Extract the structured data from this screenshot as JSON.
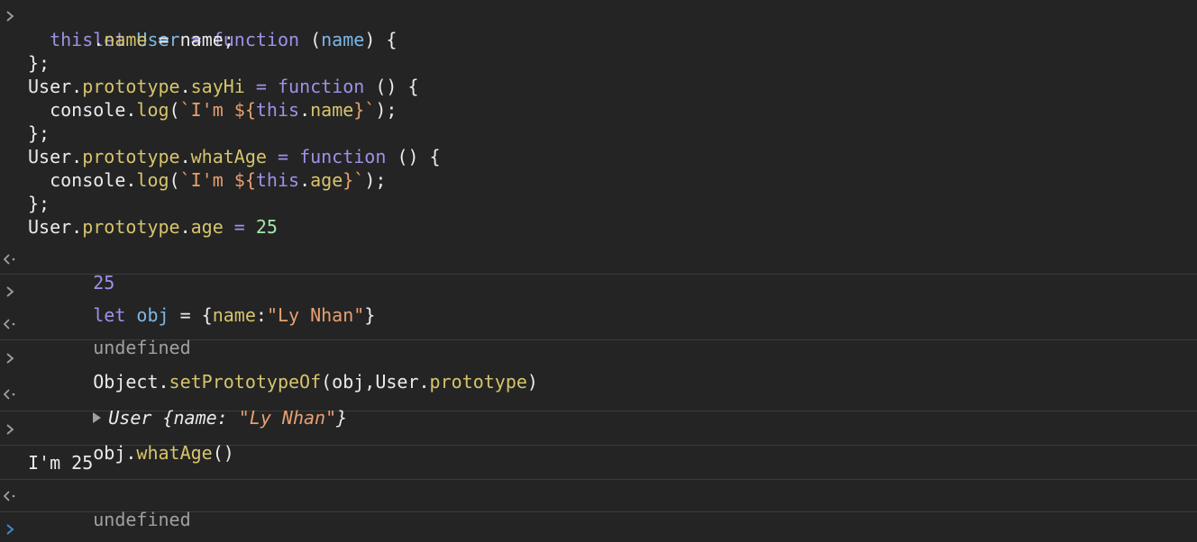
{
  "colors": {
    "background": "#242424",
    "divider": "#3c3c3c",
    "keyword": "#9c93e8",
    "variable": "#7cb7e8",
    "property": "#d6c46c",
    "string": "#e8a070",
    "number": "#a3e6a8",
    "plain": "#ebebeb",
    "muted": "#a0a0a0",
    "prompt": "#3b8bd8"
  },
  "icons": {
    "input": "chevron-right-icon",
    "result": "return-arrow-icon",
    "prompt": "prompt-caret-icon",
    "expand": "expand-triangle-icon"
  },
  "entries": {
    "e1": {
      "input": {
        "l1": {
          "a": "let ",
          "b": "User",
          "c": " = ",
          "d": "function ",
          "e": "(",
          "f": "name",
          "g": ") {"
        },
        "l2": {
          "a": "  ",
          "b": "this",
          "c": ".",
          "d": "name",
          "e": " = name;"
        },
        "l3": {
          "a": "};"
        },
        "l4": {
          "a": "User.",
          "b": "prototype",
          "c": ".",
          "d": "sayHi",
          "e": " = ",
          "f": "function ",
          "g": "() {"
        },
        "l5": {
          "a": "  console.",
          "b": "log",
          "c": "(",
          "d": "`I'm ${",
          "e": "this",
          "f": ".",
          "g": "name",
          "h": "}`",
          "i": ");"
        },
        "l6": {
          "a": "};"
        },
        "l7": {
          "a": "User.",
          "b": "prototype",
          "c": ".",
          "d": "whatAge",
          "e": " = ",
          "f": "function ",
          "g": "() {"
        },
        "l8": {
          "a": "  console.",
          "b": "log",
          "c": "(",
          "d": "`I'm ${",
          "e": "this",
          "f": ".",
          "g": "age",
          "h": "}`",
          "i": ");"
        },
        "l9": {
          "a": "};"
        },
        "l10": {
          "a": "User.",
          "b": "prototype",
          "c": ".",
          "d": "age",
          "e": " = ",
          "f": "25"
        }
      },
      "result": "25"
    },
    "e2": {
      "input": {
        "a": "let ",
        "b": "obj",
        "c": " = {",
        "d": "name",
        "e": ":",
        "f": "\"Ly Nhan\"",
        "g": "}"
      },
      "result": "undefined"
    },
    "e3": {
      "input": {
        "a": "Object.",
        "b": "setPrototypeOf",
        "c": "(obj,User.",
        "d": "prototype",
        "e": ")"
      },
      "result": {
        "a": "User {",
        "b": "name",
        "c": ": ",
        "d": "\"Ly Nhan\"",
        "e": "}"
      }
    },
    "e4": {
      "input": {
        "a": "obj.",
        "b": "whatAge",
        "c": "()"
      },
      "log": "I'm 25",
      "result": "undefined"
    }
  }
}
